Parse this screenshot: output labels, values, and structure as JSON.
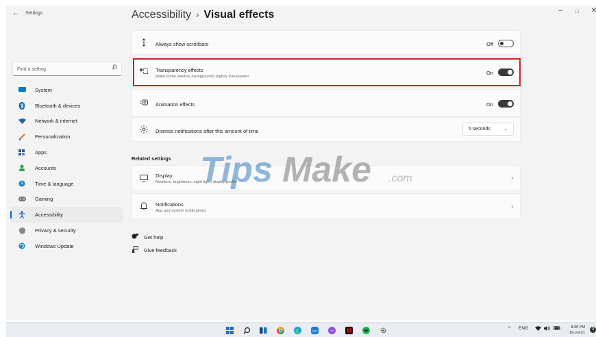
{
  "window": {
    "app_title": "Settings",
    "back_glyph": "←",
    "minimize_glyph": "–",
    "maximize_glyph": "□",
    "close_glyph": "✕"
  },
  "search": {
    "placeholder": "Find a setting",
    "icon": "search-icon"
  },
  "sidebar": {
    "items": [
      {
        "label": "System",
        "icon": "system-icon",
        "color": "#0078d4"
      },
      {
        "label": "Bluetooth & devices",
        "icon": "bluetooth-icon",
        "color": "#0063b1"
      },
      {
        "label": "Network & internet",
        "icon": "wifi-icon",
        "color": "#2b5fa8"
      },
      {
        "label": "Personalization",
        "icon": "brush-icon",
        "color": "#b5651d"
      },
      {
        "label": "Apps",
        "icon": "apps-icon",
        "color": "#3c5a8a"
      },
      {
        "label": "Accounts",
        "icon": "accounts-icon",
        "color": "#2e9e5b"
      },
      {
        "label": "Time & language",
        "icon": "globe-clock-icon",
        "color": "#1a86c9"
      },
      {
        "label": "Gaming",
        "icon": "gamepad-icon",
        "color": "#777777"
      },
      {
        "label": "Accessibility",
        "icon": "accessibility-icon",
        "color": "#1a5fb4",
        "active": true
      },
      {
        "label": "Privacy & security",
        "icon": "shield-icon",
        "color": "#888888"
      },
      {
        "label": "Windows Update",
        "icon": "update-icon",
        "color": "#1a86c9"
      }
    ]
  },
  "breadcrumb": {
    "parent": "Accessibility",
    "separator": "›",
    "current": "Visual effects"
  },
  "settings": {
    "scrollbars": {
      "title": "Always show scrollbars",
      "state": "Off",
      "icon": "scrollbar-icon"
    },
    "transparency": {
      "title": "Transparency effects",
      "subtitle": "Make some window backgrounds slightly transparent",
      "state": "On",
      "icon": "transparency-icon"
    },
    "animation": {
      "title": "Animation effects",
      "state": "On",
      "icon": "animation-icon"
    },
    "notifications_timeout": {
      "title": "Dismiss notifications after this amount of time",
      "value": "5 seconds",
      "icon": "sun-icon"
    }
  },
  "related": {
    "title": "Related settings",
    "display": {
      "title": "Display",
      "subtitle": "Monitors, brightness, night light, display profile",
      "icon": "monitor-icon"
    },
    "notifications": {
      "title": "Notifications",
      "subtitle": "App and system notifications",
      "icon": "bell-icon"
    }
  },
  "links": {
    "get_help": "Get help",
    "give_feedback": "Give feedback"
  },
  "watermark": {
    "main_a": "Tips",
    "main_b": "Make",
    "suffix": ".com"
  },
  "taskbar": {
    "tray_language": "ENG",
    "time": "8:30 PM",
    "date": "19-Jul-21",
    "badge": "3",
    "arrow": "^"
  }
}
